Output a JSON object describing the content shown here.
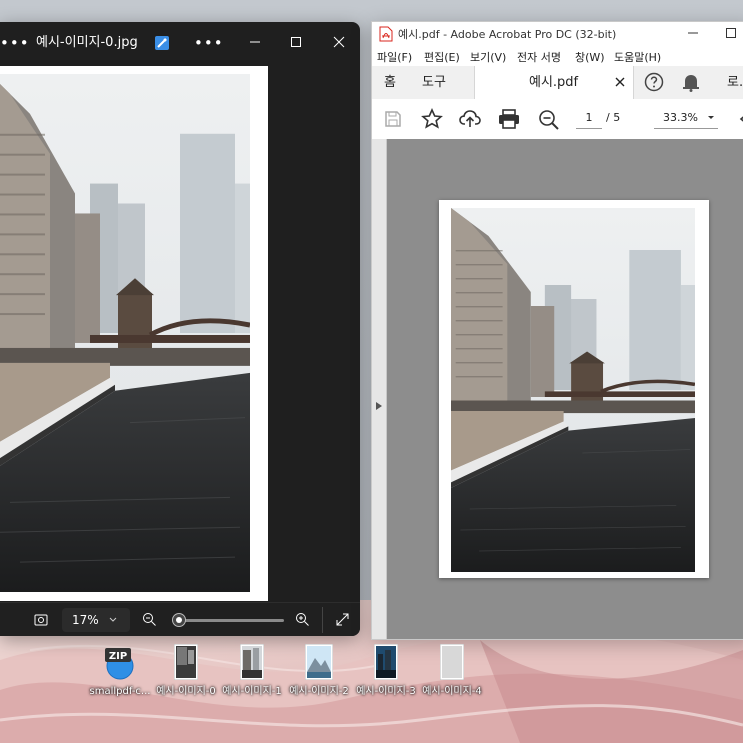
{
  "viewer": {
    "title": "예시-이미지-0.jpg",
    "zoom": "17%"
  },
  "acrobat": {
    "title": "예시.pdf - Adobe Acrobat Pro DC (32-bit)",
    "menu": [
      "파일(F)",
      "편집(E)",
      "보기(V)",
      "전자 서명",
      "창(W)",
      "도움말(H)"
    ],
    "tabs": {
      "home": "홈",
      "tools": "도구",
      "doc": "예시.pdf",
      "more": "로."
    },
    "page_current": "1",
    "page_total": "/ 5",
    "zoom": "33.3%"
  },
  "desktop": {
    "icons": [
      {
        "label": "smallpdf-c...",
        "type": "zip",
        "badge": "ZIP"
      },
      {
        "label": "예시-이미지-0",
        "type": "image"
      },
      {
        "label": "예시-이미지-1",
        "type": "image"
      },
      {
        "label": "예시-이미지-2",
        "type": "image"
      },
      {
        "label": "예시-이미지-3",
        "type": "image"
      },
      {
        "label": "예시-이미지-4",
        "type": "image"
      }
    ]
  },
  "colors": {
    "acrobat_red": "#d9261c",
    "viewer_bg": "#1f1f1f",
    "doc_bg": "#8d8d8d"
  }
}
